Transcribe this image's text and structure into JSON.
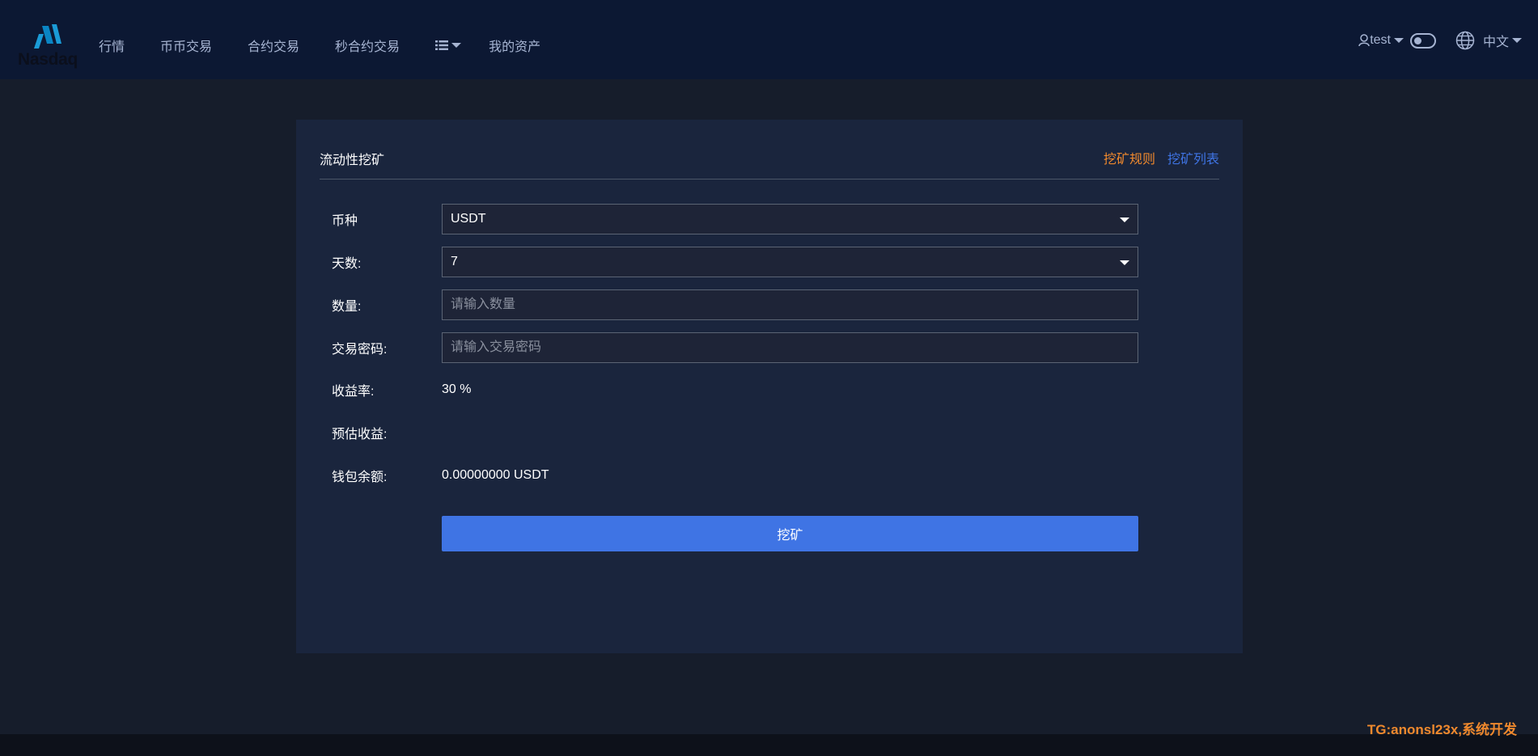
{
  "header": {
    "logo_text": "Nasdaq",
    "nav": [
      {
        "label": "行情"
      },
      {
        "label": "币币交易"
      },
      {
        "label": "合约交易"
      },
      {
        "label": "秒合约交易"
      },
      {
        "label": ""
      },
      {
        "label": "我的资产"
      }
    ],
    "user": "test",
    "language": "中文"
  },
  "card": {
    "title": "流动性挖矿",
    "link_rules": "挖矿规则",
    "link_list": "挖矿列表"
  },
  "form": {
    "currency_label": "币种",
    "currency_value": "USDT",
    "days_label": "天数:",
    "days_value": "7",
    "amount_label": "数量:",
    "amount_placeholder": "请输入数量",
    "password_label": "交易密码:",
    "password_placeholder": "请输入交易密码",
    "yield_label": "收益率:",
    "yield_value": "30 %",
    "estimate_label": "预估收益:",
    "estimate_value": "",
    "balance_label": "钱包余额:",
    "balance_value": "0.00000000 USDT",
    "submit_label": "挖矿"
  },
  "watermark": "TG:anonsl23x,系统开发",
  "colors": {
    "accent": "#3f74e4",
    "orange": "#f0892d",
    "header_bg": "#0c1833",
    "card_bg": "#1a253d",
    "page_bg": "#161d2b"
  }
}
